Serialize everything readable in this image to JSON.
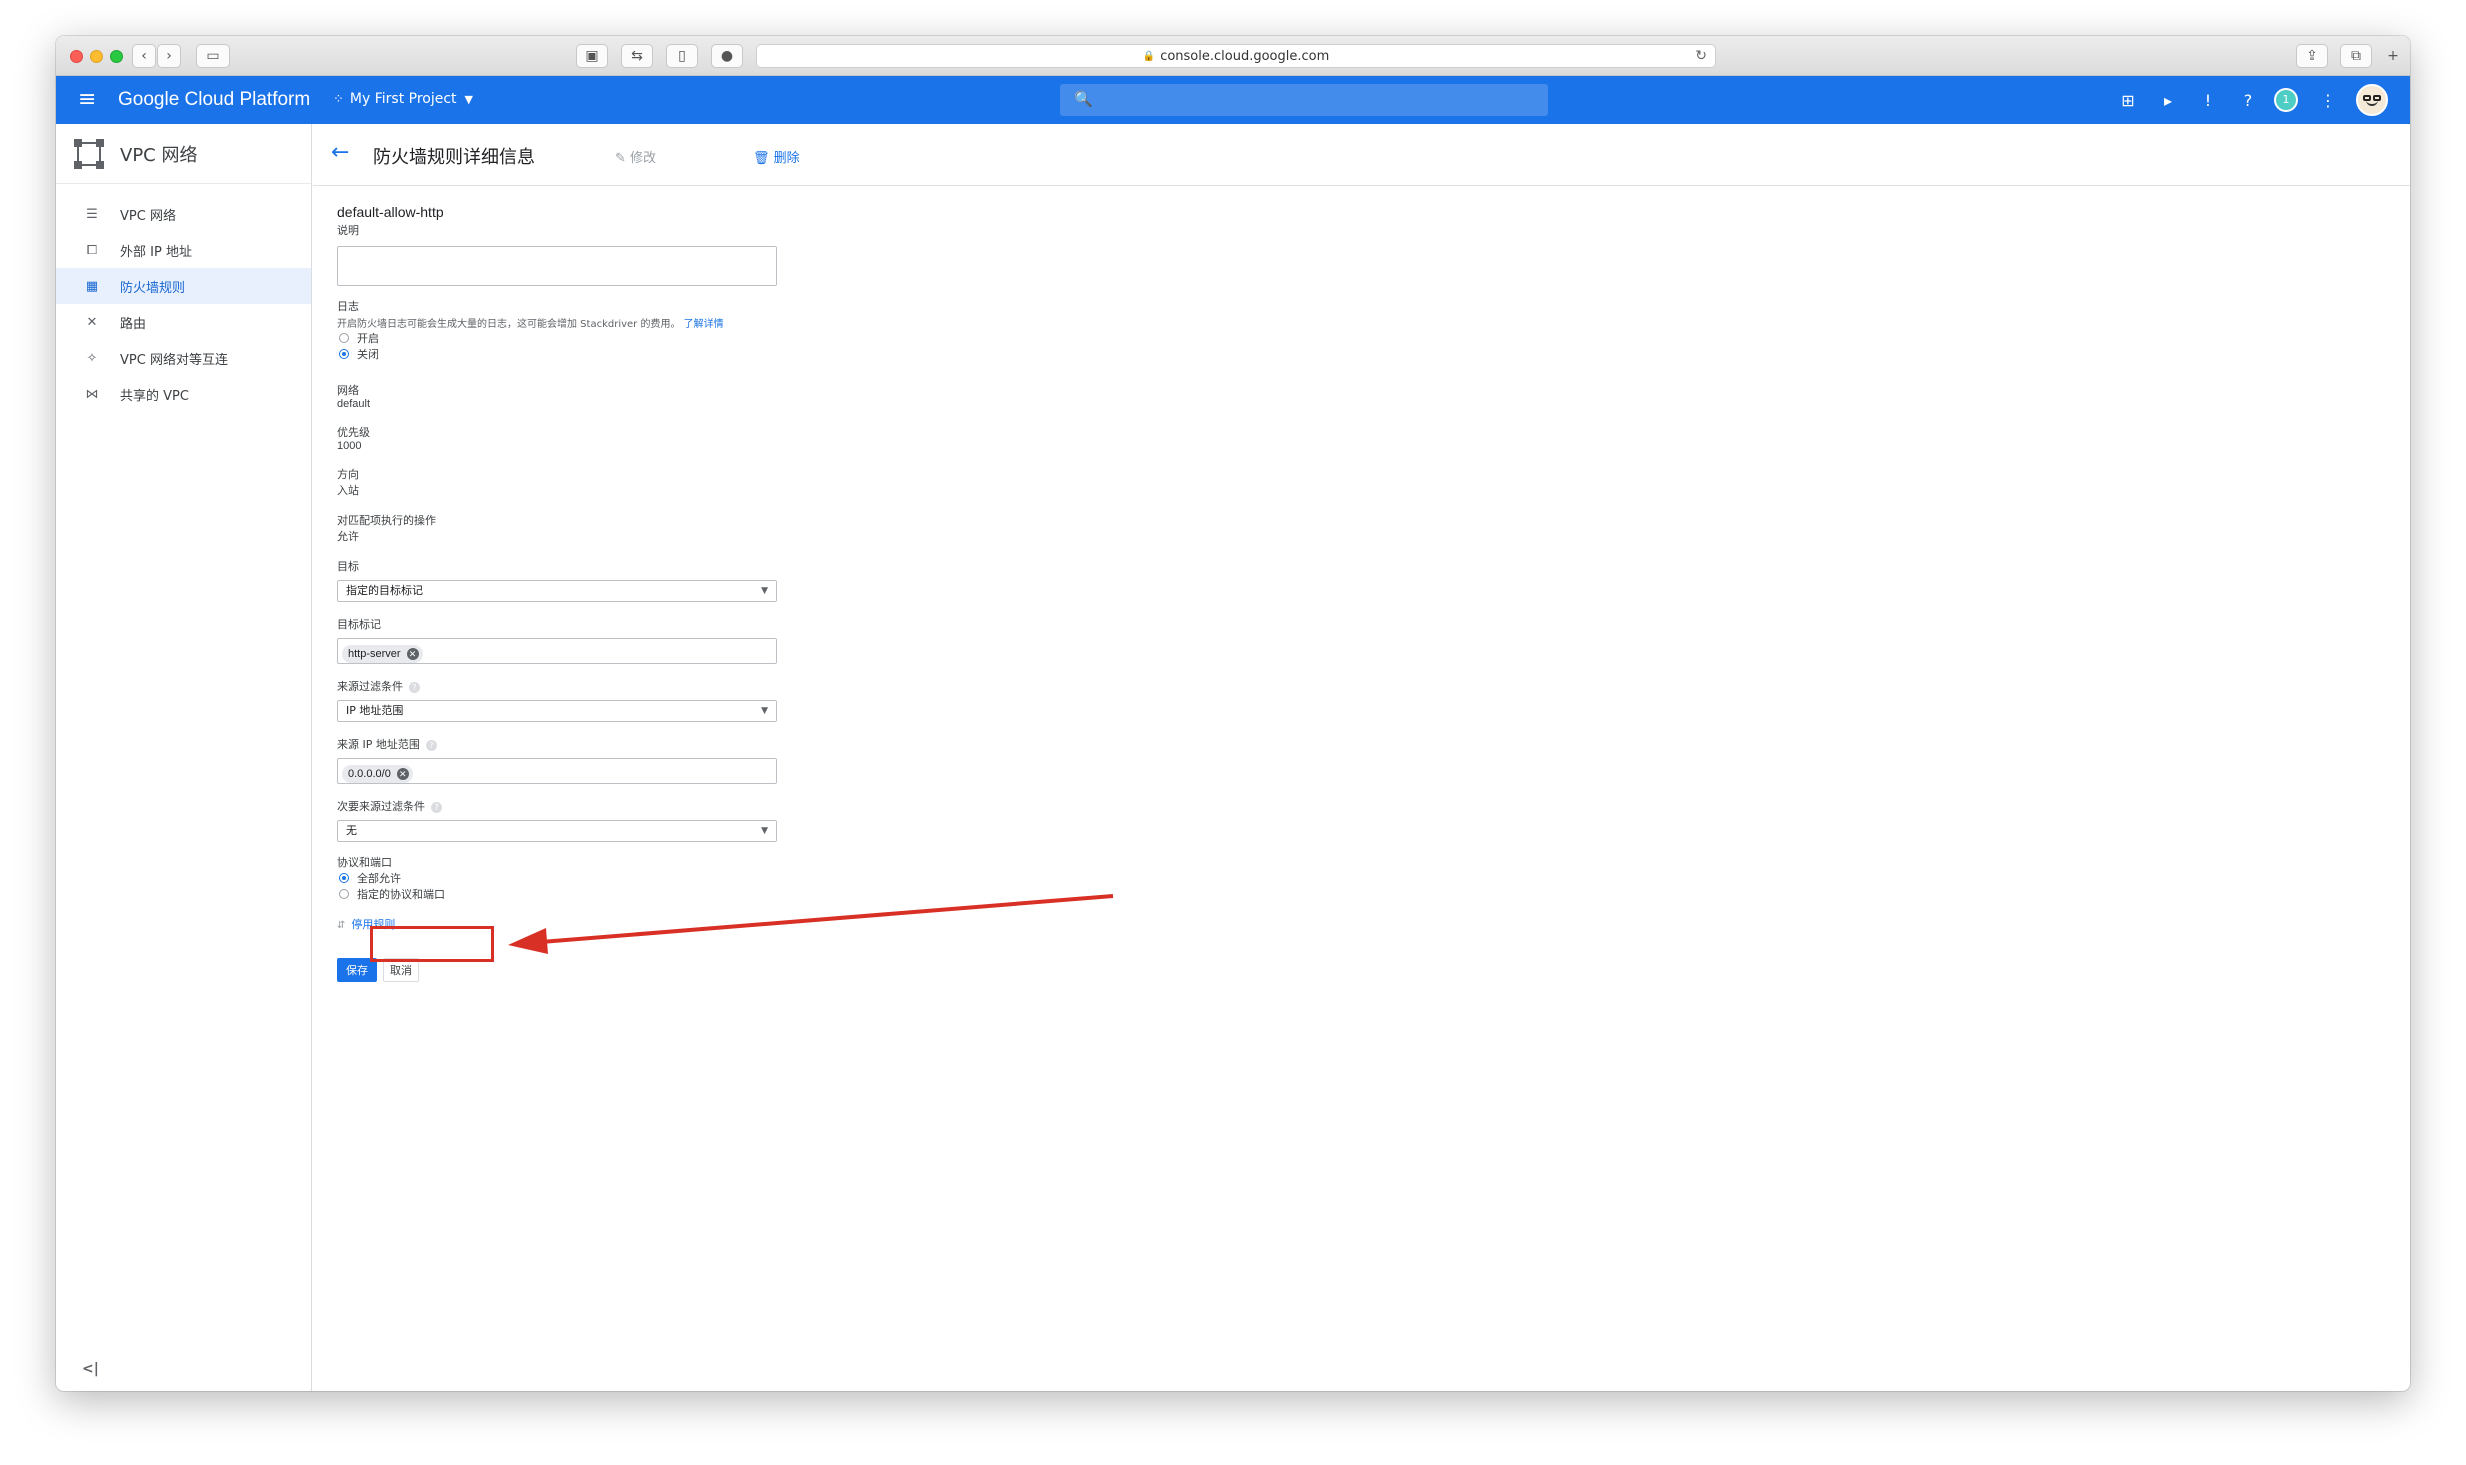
{
  "browser": {
    "url": "console.cloud.google.com"
  },
  "header": {
    "product_title": "Google Cloud Platform",
    "project_name": "My First Project",
    "search_placeholder": "",
    "notification_count": "1"
  },
  "sidebar": {
    "title": "VPC 网络",
    "items": [
      {
        "label": "VPC 网络",
        "icon": "vpc-networks-icon",
        "active": false
      },
      {
        "label": "外部 IP 地址",
        "icon": "external-ip-icon",
        "active": false
      },
      {
        "label": "防火墙规则",
        "icon": "firewall-icon",
        "active": true
      },
      {
        "label": "路由",
        "icon": "routes-icon",
        "active": false
      },
      {
        "label": "VPC 网络对等互连",
        "icon": "peering-icon",
        "active": false
      },
      {
        "label": "共享的 VPC",
        "icon": "shared-vpc-icon",
        "active": false
      }
    ],
    "collapse_label": "<|"
  },
  "page": {
    "title": "防火墙规则详细信息",
    "edit_label": "修改",
    "delete_label": "删除"
  },
  "form": {
    "rule_name": "default-allow-http",
    "description_label": "说明",
    "description_value": "",
    "logs_label": "日志",
    "logs_hint": "开启防火墙日志可能会生成大量的日志，这可能会增加 Stackdriver 的费用。",
    "logs_hint_link": "了解详情",
    "logs_on_label": "开启",
    "logs_off_label": "关闭",
    "logs_selected": "off",
    "network_label": "网络",
    "network_value": "default",
    "priority_label": "优先级",
    "priority_value": "1000",
    "direction_label": "方向",
    "direction_value": "入站",
    "action_label": "对匹配项执行的操作",
    "action_value": "允许",
    "targets_label": "目标",
    "targets_value": "指定的目标标记",
    "target_tags_label": "目标标记",
    "target_tags": [
      "http-server"
    ],
    "source_filter_label": "来源过滤条件",
    "source_filter_value": "IP 地址范围",
    "source_ip_label": "来源 IP 地址范围",
    "source_ip_ranges": [
      "0.0.0.0/0"
    ],
    "second_source_filter_label": "次要来源过滤条件",
    "second_source_filter_value": "无",
    "protocols_label": "协议和端口",
    "protocol_allow_all_label": "全部允许",
    "protocol_specified_label": "指定的协议和端口",
    "protocol_selected": "allow_all",
    "disable_rule_label": "停用规则",
    "save_label": "保存",
    "cancel_label": "取消"
  },
  "colors": {
    "header_blue": "#1a73e8",
    "annotation_red": "#d93025"
  }
}
